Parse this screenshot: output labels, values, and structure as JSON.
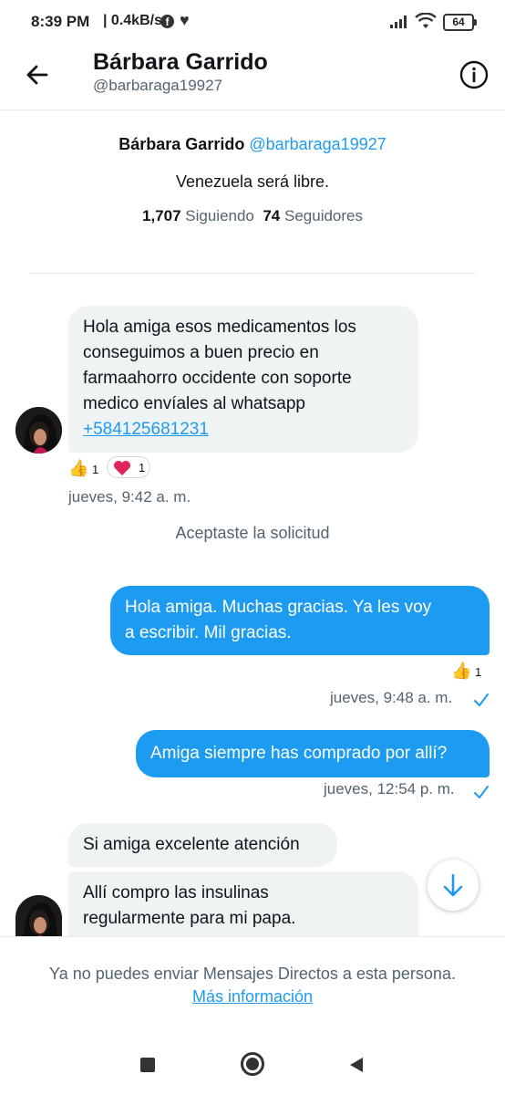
{
  "status_bar": {
    "time": "8:39 PM",
    "net_rate": "| 0.4kB/s",
    "fb_glyph": "f",
    "battery": "64"
  },
  "header": {
    "name": "Bárbara Garrido",
    "handle": "@barbaraga19927"
  },
  "profile": {
    "name": "Bárbara Garrido",
    "handle": "@barbaraga19927",
    "bio": "Venezuela será libre.",
    "following_count": "1,707",
    "following_label": "Siguiendo",
    "followers_count": "74",
    "followers_label": "Seguidores"
  },
  "messages": [
    {
      "direction": "in",
      "lines": [
        "Hola amiga esos medicamentos los",
        "conseguimos a buen precio en",
        "farmaahorro occidente con soporte",
        "medico envíales al whatsapp"
      ],
      "link": "+584125681231",
      "reactions": [
        {
          "icon": "thumbs-up",
          "count": "1"
        },
        {
          "icon": "heart",
          "count": "1"
        }
      ],
      "timestamp": "jueves, 9:42 a. m."
    },
    {
      "direction": "out",
      "lines": [
        "Hola amiga. Muchas gracias. Ya les voy",
        "a escribir. Mil gracias."
      ],
      "reactions": [
        {
          "icon": "thumbs-up",
          "count": "1"
        }
      ],
      "timestamp": "jueves, 9:48 a. m."
    },
    {
      "direction": "out",
      "lines": [
        "Amiga siempre has comprado por allí?"
      ],
      "timestamp": "jueves, 12:54 p. m."
    },
    {
      "direction": "in",
      "lines": [
        "Si amiga excelente atención"
      ]
    },
    {
      "direction": "in",
      "lines": [
        "Allí compro las insulinas",
        "regularmente para mi papa."
      ]
    }
  ],
  "system_message": "Aceptaste la solicitud",
  "footer": {
    "notice": "Ya no puedes enviar Mensajes Directos a esta persona.",
    "link": "Más información"
  },
  "colors": {
    "accent": "#1d9bf0",
    "incoming_bubble": "#eff3f4",
    "secondary_text": "#536471",
    "heart": "#e0245e",
    "thumb": "#f7c04a"
  },
  "icons": {
    "back": "arrow-left-icon",
    "info": "info-icon",
    "scroll_down": "arrow-down-icon",
    "read": "checkmark-icon"
  }
}
